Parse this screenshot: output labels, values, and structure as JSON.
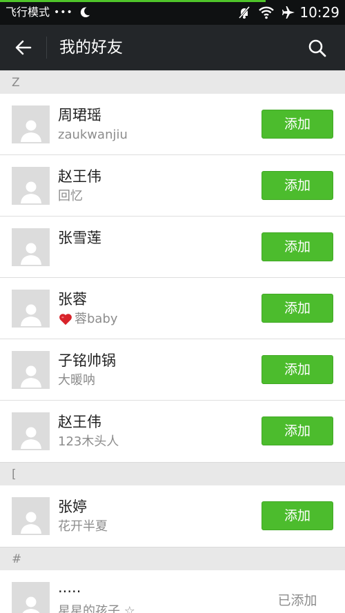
{
  "status_bar": {
    "airplane_mode_label": "飞行模式",
    "dots": "•••",
    "time": "10:29",
    "icons": [
      "moon-icon",
      "notifications-muted-icon",
      "wifi-icon",
      "airplane-icon"
    ]
  },
  "header": {
    "title": "我的好友",
    "back_icon": "back-arrow-icon",
    "search_icon": "search-icon"
  },
  "colors": {
    "accent_green": "#4cbc2d",
    "header_bg": "#232629",
    "section_bg": "#e8e8e8"
  },
  "sections": [
    {
      "letter": "Z",
      "friends": [
        {
          "name": "周珺瑶",
          "subtitle": "zaukwanjiu",
          "action": "添加"
        },
        {
          "name": "赵王伟",
          "subtitle": "回忆",
          "action": "添加"
        },
        {
          "name": "张雪莲",
          "subtitle": "",
          "action": "添加"
        },
        {
          "name": "张蓉",
          "subtitle": "蓉baby",
          "action": "添加"
        },
        {
          "name": "子铭帅锅",
          "subtitle": "大暖呐",
          "action": "添加"
        },
        {
          "name": "赵王伟",
          "subtitle": "123木头人",
          "action": "添加"
        }
      ]
    },
    {
      "letter": "[",
      "friends": [
        {
          "name": "张婷",
          "subtitle": "花开半夏",
          "action": "添加"
        }
      ]
    },
    {
      "letter": "#",
      "friends": [
        {
          "name": "·····",
          "subtitle": "星星的孩子 ☆",
          "status": "已添加"
        }
      ]
    }
  ]
}
